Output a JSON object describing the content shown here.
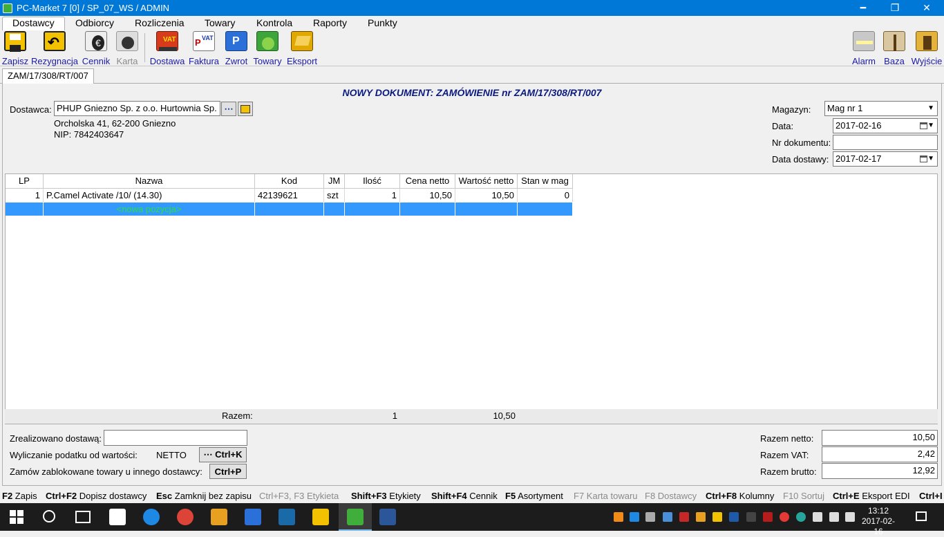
{
  "window": {
    "title": "PC-Market 7 [0] / SP_07_WS / ADMIN",
    "minimize": "━",
    "maximize": "❐",
    "close": "✕"
  },
  "menu": [
    "Dostawcy",
    "Odbiorcy",
    "Rozliczenia",
    "Towary",
    "Kontrola",
    "Raporty",
    "Punkty"
  ],
  "toolbar": {
    "left": [
      {
        "label": "Zapisz",
        "icon": "save-icon",
        "enabled": true
      },
      {
        "label": "Rezygnacja",
        "icon": "undo-icon",
        "enabled": true
      },
      {
        "label": "Cennik",
        "icon": "pricelist-icon",
        "enabled": true
      },
      {
        "label": "Karta",
        "icon": "card-icon",
        "enabled": false
      },
      {
        "label": "Dostawa",
        "icon": "delivery-vat-icon",
        "enabled": true
      },
      {
        "label": "Faktura",
        "icon": "invoice-vat-icon",
        "enabled": true
      },
      {
        "label": "Zwrot",
        "icon": "return-icon",
        "enabled": true
      },
      {
        "label": "Towary",
        "icon": "goods-icon",
        "enabled": true
      },
      {
        "label": "Eksport",
        "icon": "export-icon",
        "enabled": true
      }
    ],
    "right": [
      {
        "label": "Alarm",
        "icon": "alarm-icon"
      },
      {
        "label": "Baza",
        "icon": "database-icon"
      },
      {
        "label": "Wyjście",
        "icon": "exit-icon"
      }
    ]
  },
  "tab": "ZAM/17/308/RT/007",
  "document_title": "NOWY DOKUMENT: ZAMÓWIENIE nr ZAM/17/308/RT/007",
  "supplier": {
    "label": "Dostawca:",
    "value": "PHUP Gniezno Sp. z o.o. Hurtownia Sp.",
    "browse": "⋯",
    "address": "Orcholska 41, 62-200 Gniezno",
    "nip": "NIP: 7842403647"
  },
  "right_fields": {
    "magazyn_label": "Magazyn:",
    "magazyn_value": "Mag nr 1",
    "data_label": "Data:",
    "data_value": "2017-02-16",
    "nrdok_label": "Nr dokumentu:",
    "nrdok_value": "",
    "datadost_label": "Data dostawy:",
    "datadost_value": "2017-02-17"
  },
  "grid": {
    "columns": [
      "LP",
      "Nazwa",
      "Kod",
      "JM",
      "Ilość",
      "Cena netto",
      "Wartość netto",
      "Stan w mag"
    ],
    "rows": [
      [
        "1",
        "P.Camel Activate /10/ (14.30)",
        "42139621",
        "szt",
        "1",
        "10,50",
        "10,50",
        "0"
      ]
    ],
    "new_row": "<nowa pozycja>",
    "sum_label": "Razem:",
    "sum_qty": "1",
    "sum_value": "10,50"
  },
  "bottom": {
    "realized_label": "Zrealizowano dostawą:",
    "realized_value": "",
    "tax_label": "Wyliczanie podatku od wartości:",
    "tax_value": "NETTO",
    "tax_btn": "⋯ Ctrl+K",
    "block_label": "Zamów zablokowane towary u innego dostawcy:",
    "block_btn": "Ctrl+P",
    "net_label": "Razem netto:",
    "net_value": "10,50",
    "vat_label": "Razem VAT:",
    "vat_value": "2,42",
    "gross_label": "Razem brutto:",
    "gross_value": "12,92"
  },
  "fkeys": [
    {
      "key": "F2",
      "label": "Zapis",
      "enabled": true
    },
    {
      "key": "Ctrl+F2",
      "label": "Dopisz dostawcy",
      "enabled": true
    },
    {
      "key": "Esc",
      "label": "Zamknij bez zapisu",
      "enabled": true
    },
    {
      "key": "Ctrl+F3, F3",
      "label": "Etykieta",
      "enabled": false
    },
    {
      "key": "Shift+F3",
      "label": "Etykiety",
      "enabled": true
    },
    {
      "key": "Shift+F4",
      "label": "Cennik",
      "enabled": true
    },
    {
      "key": "F5",
      "label": "Asortyment",
      "enabled": true
    },
    {
      "key": "F7",
      "label": "Karta towaru",
      "enabled": false
    },
    {
      "key": "F8",
      "label": "Dostawcy",
      "enabled": false
    },
    {
      "key": "Ctrl+F8",
      "label": "Kolumny",
      "enabled": true
    },
    {
      "key": "F10",
      "label": "Sortuj",
      "enabled": false
    },
    {
      "key": "Ctrl+E",
      "label": "Eksport EDI",
      "enabled": true
    },
    {
      "key": "Ctrl+I",
      "label": "",
      "enabled": true
    }
  ],
  "taskbar": {
    "time": "13:12",
    "date": "2017-02-16"
  },
  "colors": {
    "titlebar": "#0078d7",
    "selection": "#3399ff",
    "new_row_text": "#27e33a",
    "doc_title": "#0a1a80"
  }
}
